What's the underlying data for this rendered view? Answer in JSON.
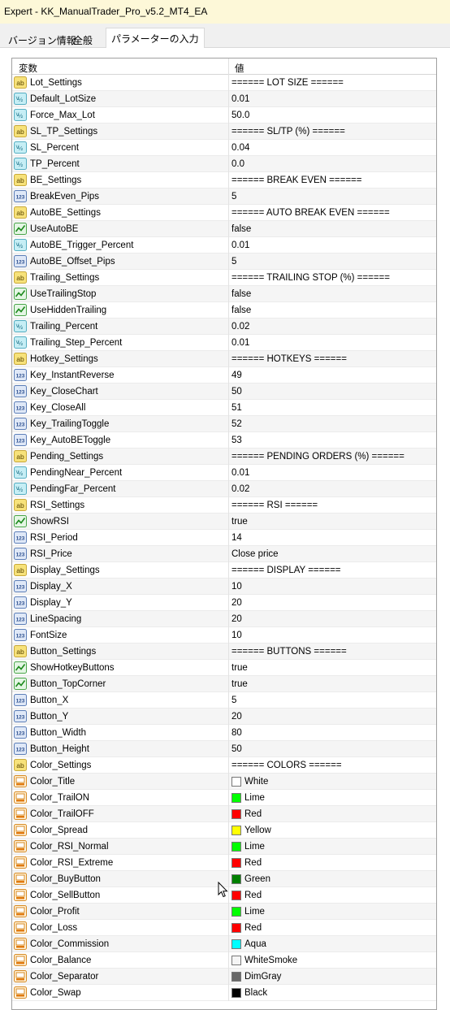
{
  "window": {
    "title": "Expert - KK_ManualTrader_Pro_v5.2_MT4_EA"
  },
  "tabs": [
    {
      "label": "バージョン情報"
    },
    {
      "label": "全般"
    },
    {
      "label": "パラメーターの入力"
    }
  ],
  "table": {
    "col_variable": "変数",
    "col_value": "値",
    "rows": [
      {
        "name": "Lot_Settings",
        "value": "====== LOT SIZE ======",
        "icon": "string-icon"
      },
      {
        "name": "Default_LotSize",
        "value": "0.01",
        "icon": "double-icon"
      },
      {
        "name": "Force_Max_Lot",
        "value": "50.0",
        "icon": "double-icon"
      },
      {
        "name": "SL_TP_Settings",
        "value": "====== SL/TP (%) ======",
        "icon": "string-icon"
      },
      {
        "name": "SL_Percent",
        "value": "0.04",
        "icon": "double-icon"
      },
      {
        "name": "TP_Percent",
        "value": "0.0",
        "icon": "double-icon"
      },
      {
        "name": "BE_Settings",
        "value": "====== BREAK EVEN ======",
        "icon": "string-icon"
      },
      {
        "name": "BreakEven_Pips",
        "value": "5",
        "icon": "integer-icon"
      },
      {
        "name": "AutoBE_Settings",
        "value": "====== AUTO BREAK EVEN ======",
        "icon": "string-icon"
      },
      {
        "name": "UseAutoBE",
        "value": "false",
        "icon": "bool-icon"
      },
      {
        "name": "AutoBE_Trigger_Percent",
        "value": "0.01",
        "icon": "double-icon"
      },
      {
        "name": "AutoBE_Offset_Pips",
        "value": "5",
        "icon": "integer-icon"
      },
      {
        "name": "Trailing_Settings",
        "value": "====== TRAILING STOP (%) ======",
        "icon": "string-icon"
      },
      {
        "name": "UseTrailingStop",
        "value": "false",
        "icon": "bool-icon"
      },
      {
        "name": "UseHiddenTrailing",
        "value": "false",
        "icon": "bool-icon"
      },
      {
        "name": "Trailing_Percent",
        "value": "0.02",
        "icon": "double-icon"
      },
      {
        "name": "Trailing_Step_Percent",
        "value": "0.01",
        "icon": "double-icon"
      },
      {
        "name": "Hotkey_Settings",
        "value": "====== HOTKEYS ======",
        "icon": "string-icon"
      },
      {
        "name": "Key_InstantReverse",
        "value": "49",
        "icon": "integer-icon"
      },
      {
        "name": "Key_CloseChart",
        "value": "50",
        "icon": "integer-icon"
      },
      {
        "name": "Key_CloseAll",
        "value": "51",
        "icon": "integer-icon"
      },
      {
        "name": "Key_TrailingToggle",
        "value": "52",
        "icon": "integer-icon"
      },
      {
        "name": "Key_AutoBEToggle",
        "value": "53",
        "icon": "integer-icon"
      },
      {
        "name": "Pending_Settings",
        "value": "====== PENDING ORDERS (%) ======",
        "icon": "string-icon"
      },
      {
        "name": "PendingNear_Percent",
        "value": "0.01",
        "icon": "double-icon"
      },
      {
        "name": "PendingFar_Percent",
        "value": "0.02",
        "icon": "double-icon"
      },
      {
        "name": "RSI_Settings",
        "value": "====== RSI ======",
        "icon": "string-icon"
      },
      {
        "name": "ShowRSI",
        "value": "true",
        "icon": "bool-icon"
      },
      {
        "name": "RSI_Period",
        "value": "14",
        "icon": "integer-icon"
      },
      {
        "name": "RSI_Price",
        "value": "Close price",
        "icon": "integer-icon"
      },
      {
        "name": "Display_Settings",
        "value": "====== DISPLAY ======",
        "icon": "string-icon"
      },
      {
        "name": "Display_X",
        "value": "10",
        "icon": "integer-icon"
      },
      {
        "name": "Display_Y",
        "value": "20",
        "icon": "integer-icon"
      },
      {
        "name": "LineSpacing",
        "value": "20",
        "icon": "integer-icon"
      },
      {
        "name": "FontSize",
        "value": "10",
        "icon": "integer-icon"
      },
      {
        "name": "Button_Settings",
        "value": "====== BUTTONS ======",
        "icon": "string-icon"
      },
      {
        "name": "ShowHotkeyButtons",
        "value": "true",
        "icon": "bool-icon"
      },
      {
        "name": "Button_TopCorner",
        "value": "true",
        "icon": "bool-icon"
      },
      {
        "name": "Button_X",
        "value": "5",
        "icon": "integer-icon"
      },
      {
        "name": "Button_Y",
        "value": "20",
        "icon": "integer-icon"
      },
      {
        "name": "Button_Width",
        "value": "80",
        "icon": "integer-icon"
      },
      {
        "name": "Button_Height",
        "value": "50",
        "icon": "integer-icon"
      },
      {
        "name": "Color_Settings",
        "value": "====== COLORS ======",
        "icon": "string-icon"
      },
      {
        "name": "Color_Title",
        "value": "White",
        "icon": "color-icon",
        "swatch": "#ffffff"
      },
      {
        "name": "Color_TrailON",
        "value": "Lime",
        "icon": "color-icon",
        "swatch": "#00ff00"
      },
      {
        "name": "Color_TrailOFF",
        "value": "Red",
        "icon": "color-icon",
        "swatch": "#ff0000"
      },
      {
        "name": "Color_Spread",
        "value": "Yellow",
        "icon": "color-icon",
        "swatch": "#ffff00"
      },
      {
        "name": "Color_RSI_Normal",
        "value": "Lime",
        "icon": "color-icon",
        "swatch": "#00ff00"
      },
      {
        "name": "Color_RSI_Extreme",
        "value": "Red",
        "icon": "color-icon",
        "swatch": "#ff0000"
      },
      {
        "name": "Color_BuyButton",
        "value": "Green",
        "icon": "color-icon",
        "swatch": "#008000"
      },
      {
        "name": "Color_SellButton",
        "value": "Red",
        "icon": "color-icon",
        "swatch": "#ff0000"
      },
      {
        "name": "Color_Profit",
        "value": "Lime",
        "icon": "color-icon",
        "swatch": "#00ff00"
      },
      {
        "name": "Color_Loss",
        "value": "Red",
        "icon": "color-icon",
        "swatch": "#ff0000"
      },
      {
        "name": "Color_Commission",
        "value": "Aqua",
        "icon": "color-icon",
        "swatch": "#00ffff"
      },
      {
        "name": "Color_Balance",
        "value": "WhiteSmoke",
        "icon": "color-icon",
        "swatch": "#f5f5f5"
      },
      {
        "name": "Color_Separator",
        "value": "DimGray",
        "icon": "color-icon",
        "swatch": "#696969"
      },
      {
        "name": "Color_Swap",
        "value": "Black",
        "icon": "color-icon",
        "swatch": "#000000"
      }
    ]
  }
}
